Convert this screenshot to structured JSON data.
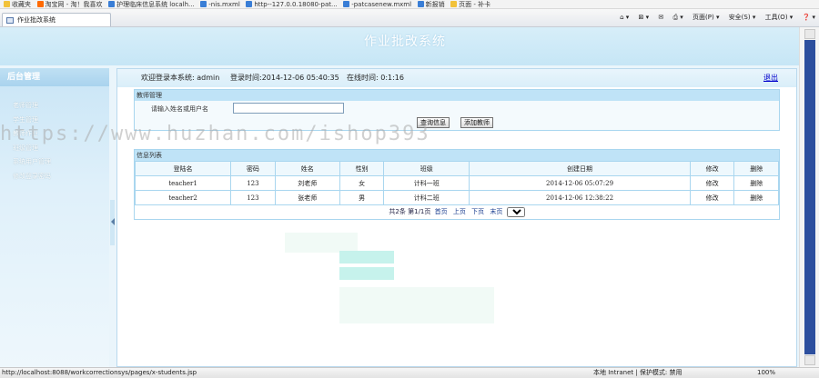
{
  "browser": {
    "favorites": [
      {
        "label": "收藏夹",
        "color": "#f2c23a"
      },
      {
        "label": "淘宝网 - 淘！我喜欢",
        "color": "#ff6a00"
      },
      {
        "label": "护理临床信息系统 localh...",
        "color": "#3a7ed6"
      },
      {
        "label": "-nis.mxml",
        "color": "#3a7ed6"
      },
      {
        "label": "http--127.0.0.18080-pat...",
        "color": "#3a7ed6"
      },
      {
        "label": "-patcasenew.mxml",
        "color": "#3a7ed6"
      },
      {
        "label": "新报销",
        "color": "#3a7ed6"
      },
      {
        "label": "页面 - 补卡",
        "color": "#f2c23a"
      }
    ],
    "tab_title": "作业批改系统",
    "commands": {
      "page": "页面(P) ▾",
      "safety": "安全(S) ▾",
      "tools": "工具(O) ▾",
      "help": "❓ ▾"
    },
    "status_url": "http://localhost:8088/workcorrectionsys/pages/x-students.jsp",
    "status_zone": "本地 Intranet | 保护模式: 禁用",
    "status_zoom": "100%"
  },
  "app": {
    "title": "作业批改系统",
    "sidebar": {
      "title": "后台管理",
      "items": [
        "老师管理",
        "学生管理",
        "教师作业",
        "班级管理",
        "系统用户管理",
        "修改登录密码"
      ]
    },
    "welcome": {
      "user": "欢迎登录本系统: admin",
      "login_time": "登录时间:2014-12-06 05:40:35",
      "online_time": "在线时间: 0:1:16",
      "logout": "退出"
    },
    "search_panel": {
      "title": "教师管理",
      "label": "请输入姓名或用户名",
      "input_value": "",
      "query_button": "查询信息",
      "add_button": "添加教师"
    },
    "list_panel": {
      "title": "信息列表",
      "columns": [
        "登陆名",
        "密码",
        "姓名",
        "性别",
        "班级",
        "创建日期",
        "修改",
        "删除"
      ],
      "rows": [
        {
          "login": "teacher1",
          "password": "123",
          "name": "刘老师",
          "gender": "女",
          "class": "计科一班",
          "created": "2014-12-06 05:07:29",
          "edit": "修改",
          "delete": "删除"
        },
        {
          "login": "teacher2",
          "password": "123",
          "name": "张老师",
          "gender": "男",
          "class": "计科二班",
          "created": "2014-12-06 12:38:22",
          "edit": "修改",
          "delete": "删除"
        }
      ],
      "pager": {
        "total": "共2条",
        "page_info": "第1/1页",
        "first": "首页",
        "prev": "上页",
        "next": "下页",
        "last": "末页",
        "page_select": "1"
      }
    }
  },
  "watermark": "https://www.huzhan.com/ishop393"
}
